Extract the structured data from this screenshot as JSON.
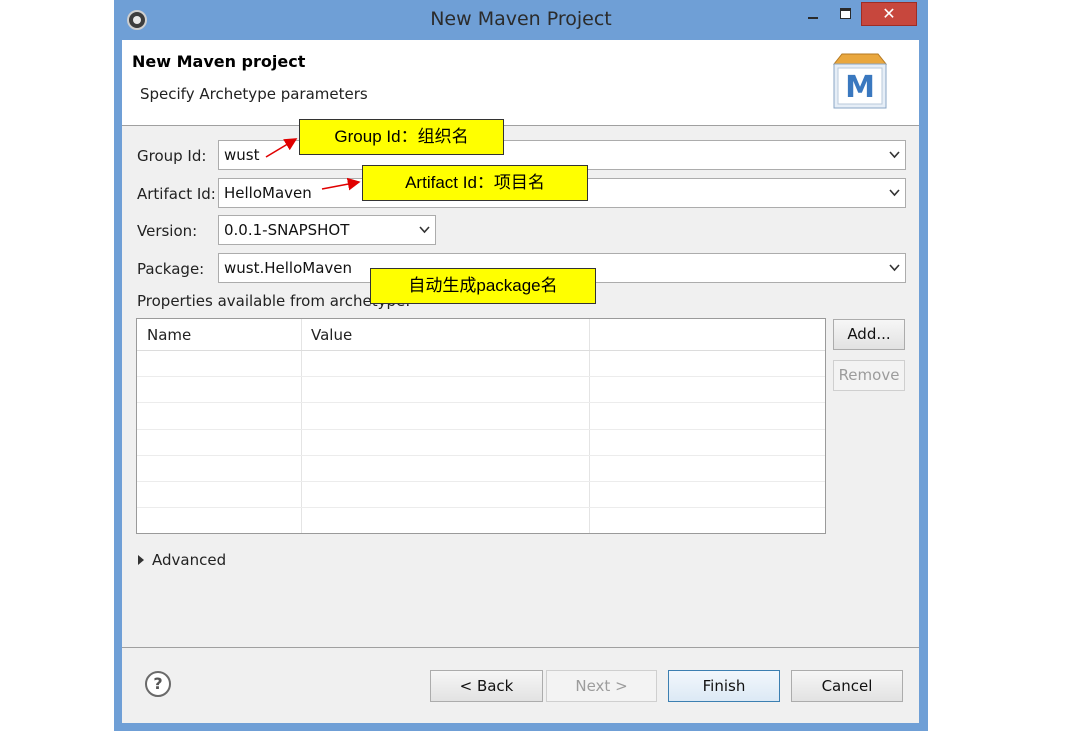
{
  "window": {
    "title": "New Maven Project",
    "close_label": "✕"
  },
  "header": {
    "title": "New Maven project",
    "subtitle": "Specify Archetype parameters",
    "logo_letter": "M"
  },
  "form": {
    "group_id_label": "Group Id:",
    "group_id_value": "wust",
    "artifact_id_label": "Artifact Id:",
    "artifact_id_value": "HelloMaven",
    "version_label": "Version:",
    "version_value": "0.0.1-SNAPSHOT",
    "package_label": "Package:",
    "package_value": "wust.HelloMaven",
    "properties_label": "Properties available from archetype:"
  },
  "table": {
    "columns": [
      "Name",
      "Value",
      ""
    ],
    "rows": []
  },
  "side_buttons": {
    "add": "Add...",
    "remove": "Remove"
  },
  "advanced_label": "Advanced",
  "footer": {
    "help_icon": "?",
    "back": "< Back",
    "next": "Next >",
    "finish": "Finish",
    "cancel": "Cancel"
  },
  "annotations": {
    "group_note": "Group Id：组织名",
    "artifact_note": "Artifact Id：项目名",
    "package_note": "自动生成package名"
  },
  "colors": {
    "titlebar": "#6f9fd6",
    "close": "#c7473d",
    "note_fill": "#ffff00",
    "arrow": "#e00000"
  }
}
